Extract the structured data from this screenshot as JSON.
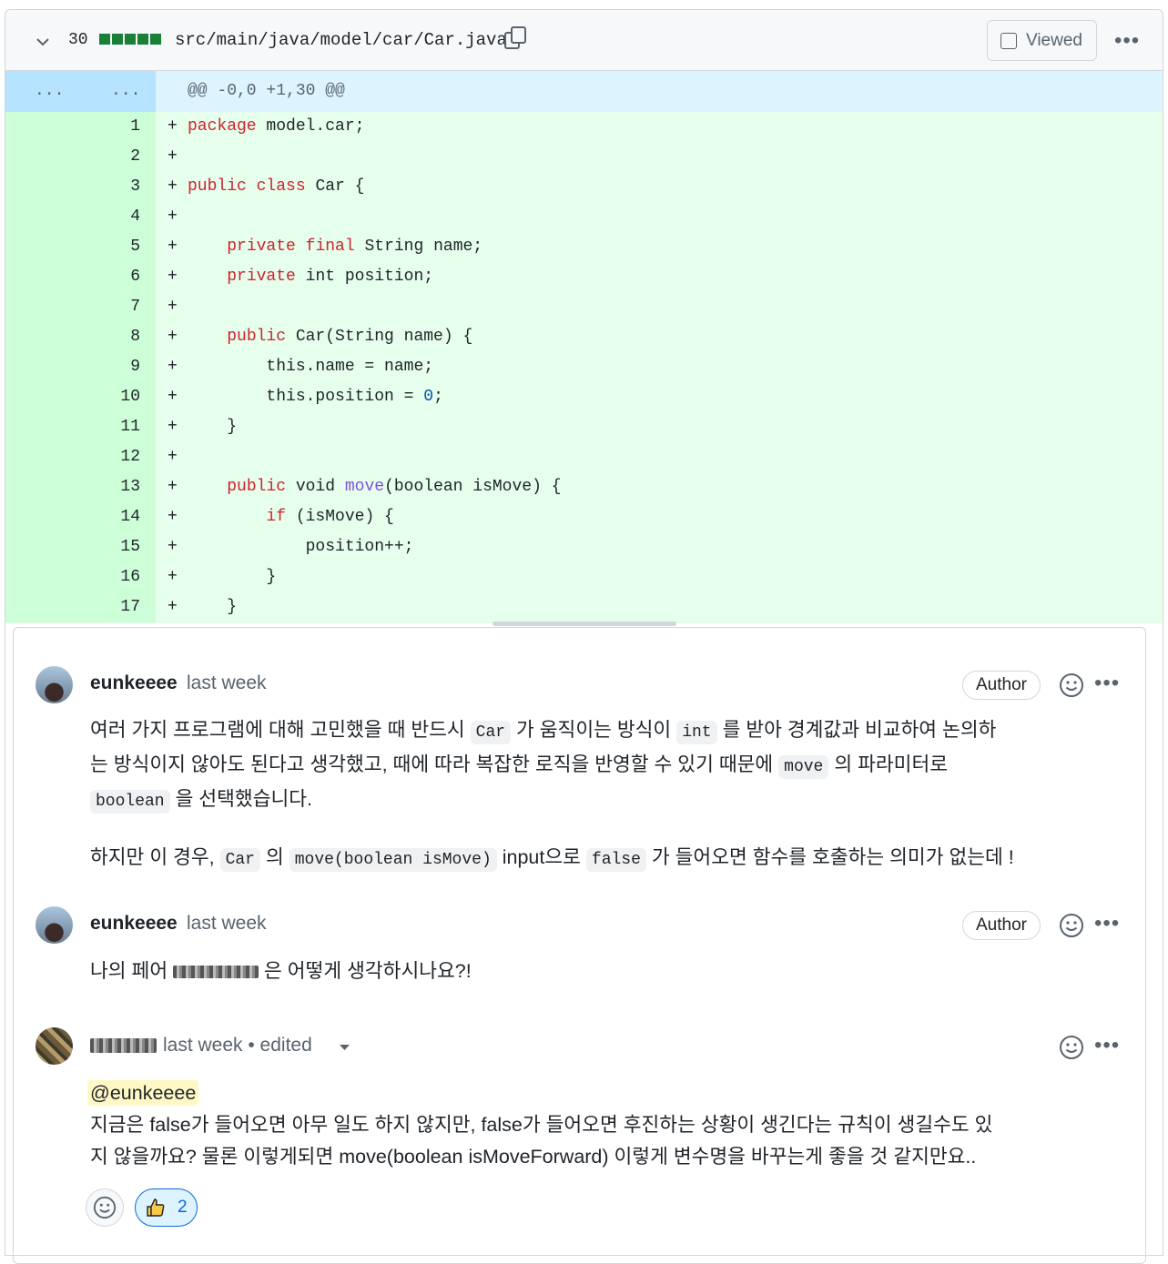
{
  "file": {
    "changes_count": "30",
    "path": "src/main/java/model/car/Car.java",
    "viewed_label": "Viewed",
    "icons": {
      "collapse": "chevron-down-icon",
      "copy": "copy-icon",
      "more": "kebab-horizontal-icon"
    }
  },
  "hunk": {
    "left_dots": "...",
    "right_dots": "...",
    "header": "@@ -0,0 +1,30 @@"
  },
  "lines": [
    {
      "num": "1",
      "sign": "+",
      "text": "package model.car;"
    },
    {
      "num": "2",
      "sign": "+",
      "text": ""
    },
    {
      "num": "3",
      "sign": "+",
      "text": "public class Car {"
    },
    {
      "num": "4",
      "sign": "+",
      "text": ""
    },
    {
      "num": "5",
      "sign": "+",
      "text": "    private final String name;"
    },
    {
      "num": "6",
      "sign": "+",
      "text": "    private int position;"
    },
    {
      "num": "7",
      "sign": "+",
      "text": ""
    },
    {
      "num": "8",
      "sign": "+",
      "text": "    public Car(String name) {"
    },
    {
      "num": "9",
      "sign": "+",
      "text": "        this.name = name;"
    },
    {
      "num": "10",
      "sign": "+",
      "text": "        this.position = 0;"
    },
    {
      "num": "11",
      "sign": "+",
      "text": "    }"
    },
    {
      "num": "12",
      "sign": "+",
      "text": ""
    },
    {
      "num": "13",
      "sign": "+",
      "text": "    public void move(boolean isMove) {"
    },
    {
      "num": "14",
      "sign": "+",
      "text": "        if (isMove) {"
    },
    {
      "num": "15",
      "sign": "+",
      "text": "            position++;"
    },
    {
      "num": "16",
      "sign": "+",
      "text": "        }"
    },
    {
      "num": "17",
      "sign": "+",
      "text": "    }"
    }
  ],
  "comments": [
    {
      "author": "eunkeeee",
      "time": "last week",
      "badge": "Author",
      "p1": {
        "a": "여러 가지 프로그램에 대해 고민했을 때 반드시 ",
        "code1": "Car",
        "b": " 가 움직이는 방식이 ",
        "code2": "int",
        "c": " 를 받아 경계값과 비교하여 논의하",
        "d": "는 방식이지 않아도 된다고 생각했고, 때에 따라 복잡한 로직을 반영할 수 있기 때문에 ",
        "code3": "move",
        "e": " 의 파라미터로",
        "code4": "boolean",
        "f": " 을 선택했습니다."
      },
      "p2": {
        "a": "하지만 이 경우, ",
        "code1": "Car",
        "b": " 의 ",
        "code2": "move(boolean isMove)",
        "c": " input으로 ",
        "code3": "false",
        "d": " 가 들어오면 함수를 호출하는 의미가 없는데 !"
      }
    },
    {
      "author": "eunkeeee",
      "time": "last week",
      "badge": "Author",
      "p1": {
        "a": "나의 페어 ",
        "b": " 은 어떻게 생각하시나요?!"
      }
    },
    {
      "time": "last week • edited",
      "mention": "@eunkeeee",
      "line1": "지금은 false가 들어오면 아무 일도 하지 않지만, false가 들어오면 후진하는 상황이 생긴다는 규칙이 생길수도 있",
      "line2": "지 않을까요? 물론 이렇게되면 move(boolean isMoveForward) 이렇게 변수명을 바꾸는게 좋을 것 같지만요..",
      "reactions": [
        {
          "icon": "thumbsup-icon",
          "count": "2"
        }
      ]
    }
  ],
  "colors": {
    "addition_bg": "#e6ffec",
    "addition_gutter": "#ccffd8",
    "hunk_bg": "#ddf4ff",
    "keyword": "#cf222e",
    "function": "#8250df",
    "number": "#0550ae",
    "accent": "#0969da"
  }
}
